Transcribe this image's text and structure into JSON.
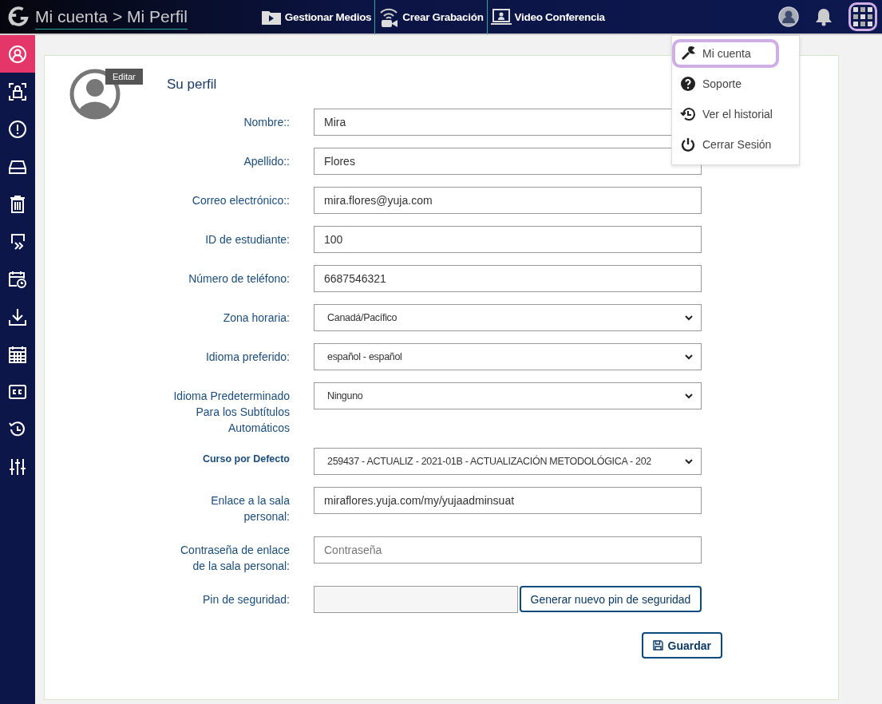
{
  "header": {
    "breadcrumb": "Mi cuenta > Mi Perfil",
    "nav": [
      {
        "label": "Gestionar Medios",
        "kind": "media"
      },
      {
        "label": "Crear Grabación",
        "kind": "record"
      },
      {
        "label": "Video Conferencia",
        "kind": "conference"
      }
    ],
    "apps_menu_open": true
  },
  "sidebar": {
    "items": [
      {
        "kind": "profile",
        "selected": true
      },
      {
        "kind": "lock",
        "selected": false
      },
      {
        "kind": "alert",
        "selected": false
      },
      {
        "kind": "drive",
        "selected": false
      },
      {
        "kind": "trash",
        "selected": false
      },
      {
        "kind": "forward",
        "selected": false
      },
      {
        "kind": "schedule",
        "selected": false
      },
      {
        "kind": "download",
        "selected": false
      },
      {
        "kind": "calendar",
        "selected": false
      },
      {
        "kind": "captions",
        "selected": false
      },
      {
        "kind": "history",
        "selected": false
      },
      {
        "kind": "sliders",
        "selected": false
      }
    ]
  },
  "profile": {
    "edit_label": "Editar",
    "title": "Su perfil",
    "fields": [
      {
        "label": "Nombre::",
        "kind": "text",
        "value": "Mira"
      },
      {
        "label": "Apellido::",
        "kind": "text",
        "value": "Flores"
      },
      {
        "label": "Correo electrónico::",
        "kind": "text",
        "value": "mira.flores@yuja.com"
      },
      {
        "label": "ID de estudiante:",
        "kind": "text",
        "value": "100"
      },
      {
        "label": "Número de teléfono:",
        "kind": "text",
        "value": "6687546321"
      },
      {
        "label": "Zona horaria:",
        "kind": "select",
        "value": "Canadá/Pacífico"
      },
      {
        "label": "Idioma preferido:",
        "kind": "select",
        "value": "español - español"
      },
      {
        "label": "Idioma Predeterminado Para los Subtítulos Automáticos",
        "kind": "select",
        "value": "Ninguno"
      },
      {
        "label": "Curso por Defecto",
        "kind": "select",
        "bold_label": true,
        "value": "259437 - ACTUALIZ - 2021-01B - ACTUALIZACIÓN METODOLÓGICA - 202"
      },
      {
        "label": "Enlace a la sala personal:",
        "kind": "text",
        "value": "miraflores.yuja.com/my/yujaadminsuat"
      },
      {
        "label": "Contraseña de enlace de la sala personal:",
        "kind": "password",
        "placeholder": "Contraseña"
      },
      {
        "label": "Pin de seguridad:",
        "kind": "pin",
        "button": "Generar nuevo pin de seguridad"
      }
    ],
    "save_button": "Guardar"
  },
  "menu": {
    "items": [
      {
        "label": "Mi cuenta",
        "kind": "wrench",
        "selected": true
      },
      {
        "label": "Soporte",
        "kind": "help",
        "selected": false
      },
      {
        "label": "Ver el historial",
        "kind": "history",
        "selected": false
      },
      {
        "label": "Cerrar Sesión",
        "kind": "power",
        "selected": false
      }
    ]
  }
}
